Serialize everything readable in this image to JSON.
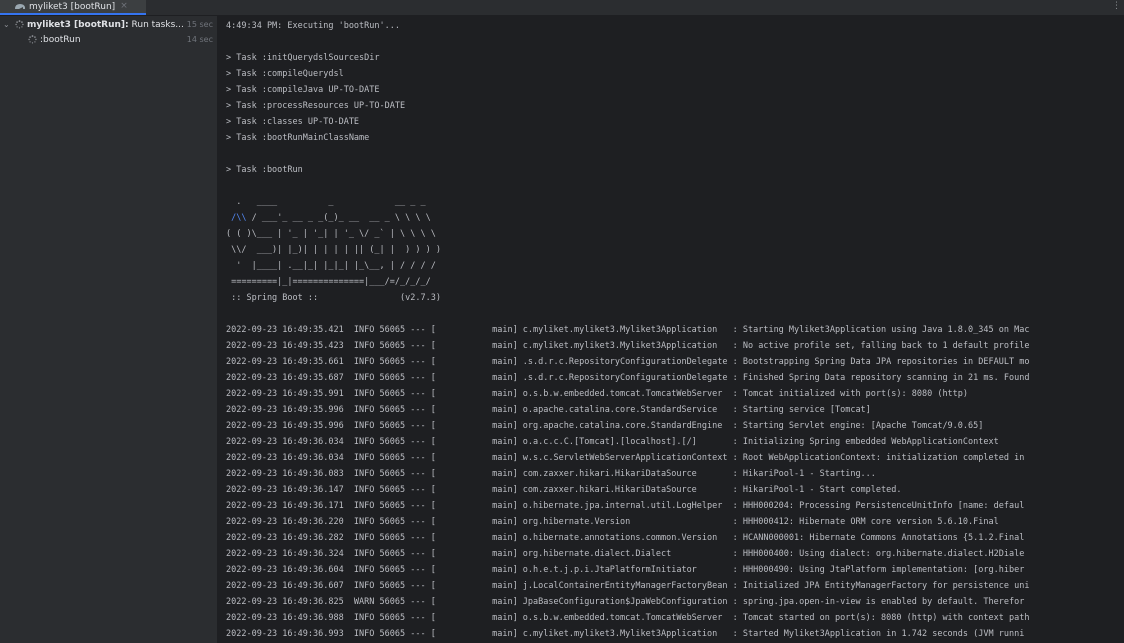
{
  "tab": {
    "title": "myliket3 [bootRun]",
    "close": "×",
    "pin": "⋮"
  },
  "tree": {
    "root": {
      "name": "myliket3 [bootRun]:",
      "status": " Run tasks...",
      "time": "15 sec"
    },
    "child": {
      "name": ":bootRun",
      "time": "14 sec"
    }
  },
  "console": {
    "lines": [
      "4:49:34 PM: Executing 'bootRun'...",
      "",
      "> Task :initQuerydslSourcesDir",
      "> Task :compileQuerydsl",
      "> Task :compileJava UP-TO-DATE",
      "> Task :processResources UP-TO-DATE",
      "> Task :classes UP-TO-DATE",
      "> Task :bootRunMainClassName",
      "",
      "> Task :bootRun",
      "",
      "  .   ____          _            __ _ _",
      " /\\\\ / ___'_ __ _ _(_)_ __  __ _ \\ \\ \\ \\",
      "( ( )\\___ | '_ | '_| | '_ \\/ _` | \\ \\ \\ \\",
      " \\\\/  ___)| |_)| | | | | || (_| |  ) ) ) )",
      "  '  |____| .__|_| |_|_| |_\\__, | / / / /",
      " =========|_|==============|___/=/_/_/_/",
      " :: Spring Boot ::                (v2.7.3)",
      "",
      "2022-09-23 16:49:35.421  INFO 56065 --- [           main] c.myliket.myliket3.Myliket3Application   : Starting Myliket3Application using Java 1.8.0_345 on Mac",
      "2022-09-23 16:49:35.423  INFO 56065 --- [           main] c.myliket.myliket3.Myliket3Application   : No active profile set, falling back to 1 default profile",
      "2022-09-23 16:49:35.661  INFO 56065 --- [           main] .s.d.r.c.RepositoryConfigurationDelegate : Bootstrapping Spring Data JPA repositories in DEFAULT mo",
      "2022-09-23 16:49:35.687  INFO 56065 --- [           main] .s.d.r.c.RepositoryConfigurationDelegate : Finished Spring Data repository scanning in 21 ms. Found",
      "2022-09-23 16:49:35.991  INFO 56065 --- [           main] o.s.b.w.embedded.tomcat.TomcatWebServer  : Tomcat initialized with port(s): 8080 (http)",
      "2022-09-23 16:49:35.996  INFO 56065 --- [           main] o.apache.catalina.core.StandardService   : Starting service [Tomcat]",
      "2022-09-23 16:49:35.996  INFO 56065 --- [           main] org.apache.catalina.core.StandardEngine  : Starting Servlet engine: [Apache Tomcat/9.0.65]",
      "2022-09-23 16:49:36.034  INFO 56065 --- [           main] o.a.c.c.C.[Tomcat].[localhost].[/]       : Initializing Spring embedded WebApplicationContext",
      "2022-09-23 16:49:36.034  INFO 56065 --- [           main] w.s.c.ServletWebServerApplicationContext : Root WebApplicationContext: initialization completed in",
      "2022-09-23 16:49:36.083  INFO 56065 --- [           main] com.zaxxer.hikari.HikariDataSource       : HikariPool-1 - Starting...",
      "2022-09-23 16:49:36.147  INFO 56065 --- [           main] com.zaxxer.hikari.HikariDataSource       : HikariPool-1 - Start completed.",
      "2022-09-23 16:49:36.171  INFO 56065 --- [           main] o.hibernate.jpa.internal.util.LogHelper  : HHH000204: Processing PersistenceUnitInfo [name: defaul",
      "2022-09-23 16:49:36.220  INFO 56065 --- [           main] org.hibernate.Version                    : HHH000412: Hibernate ORM core version 5.6.10.Final",
      "2022-09-23 16:49:36.282  INFO 56065 --- [           main] o.hibernate.annotations.common.Version   : HCANN000001: Hibernate Commons Annotations {5.1.2.Final",
      "2022-09-23 16:49:36.324  INFO 56065 --- [           main] org.hibernate.dialect.Dialect            : HHH000400: Using dialect: org.hibernate.dialect.H2Diale",
      "2022-09-23 16:49:36.604  INFO 56065 --- [           main] o.h.e.t.j.p.i.JtaPlatformInitiator       : HHH000490: Using JtaPlatform implementation: [org.hiber",
      "2022-09-23 16:49:36.607  INFO 56065 --- [           main] j.LocalContainerEntityManagerFactoryBean : Initialized JPA EntityManagerFactory for persistence uni",
      "2022-09-23 16:49:36.825  WARN 56065 --- [           main] JpaBaseConfiguration$JpaWebConfiguration : spring.jpa.open-in-view is enabled by default. Therefor",
      "2022-09-23 16:49:36.988  INFO 56065 --- [           main] o.s.b.w.embedded.tomcat.TomcatWebServer  : Tomcat started on port(s): 8080 (http) with context path",
      "2022-09-23 16:49:36.993  INFO 56065 --- [           main] c.myliket.myliket3.Myliket3Application   : Started Myliket3Application in 1.742 seconds (JVM runni"
    ]
  }
}
